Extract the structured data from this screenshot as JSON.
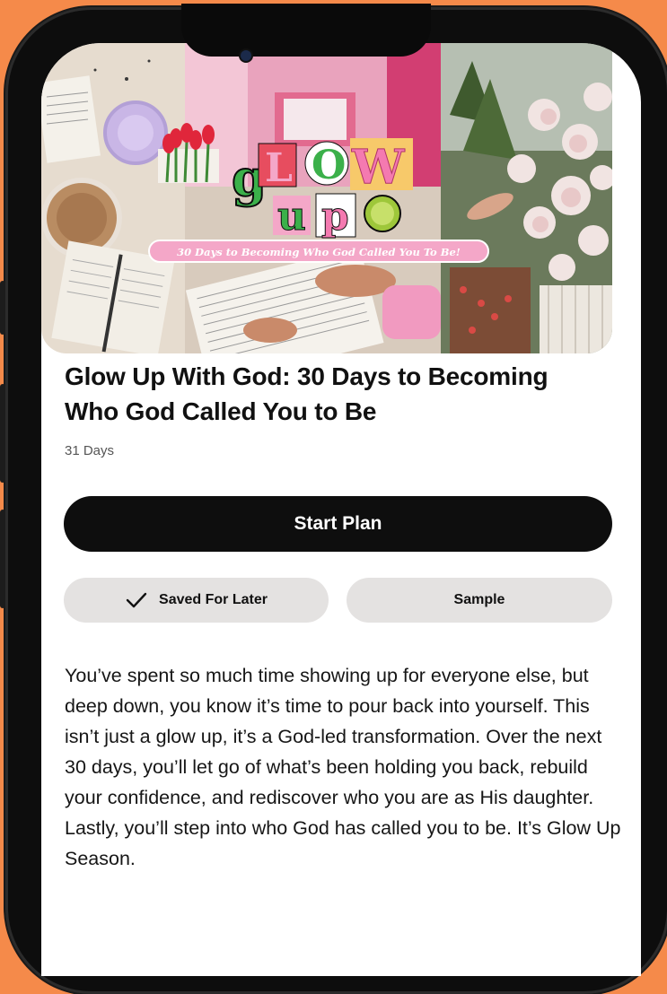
{
  "hero": {
    "title_word1": "gLOW",
    "title_word2": "up",
    "banner": "30 Days to Becoming Who God Called You To Be!"
  },
  "plan": {
    "title": "Glow Up With God: 30 Days to Becoming Who God Called You to Be",
    "duration": "31 Days",
    "start_label": "Start Plan",
    "saved_label": "Saved For Later",
    "sample_label": "Sample",
    "description": "You’ve spent so much time showing up for everyone else, but deep down, you know it’s time to pour back into yourself. This isn’t just a glow up, it’s a God-led transformation. Over the next 30 days, you’ll let go of what’s been holding you back, rebuild your confidence, and rediscover who you are as His daughter. Lastly, you’ll step into who God has called you to be. It’s Glow Up Season."
  },
  "icons": {
    "saved": "checkmark-icon",
    "camera": "front-camera-icon"
  },
  "colors": {
    "background": "#f58a4a",
    "button_dark": "#0e0e0e",
    "pill_bg": "#e4e2e1",
    "banner_pink": "#f4a7c8"
  }
}
